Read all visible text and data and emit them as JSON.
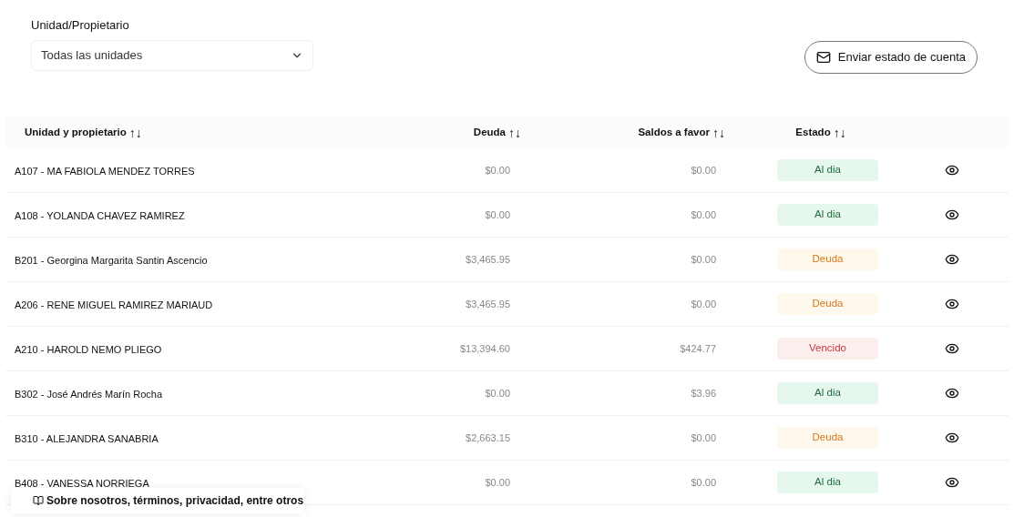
{
  "filter": {
    "label": "Unidad/Propietario",
    "value": "Todas las unidades"
  },
  "send_button": {
    "label": "Enviar estado de cuenta"
  },
  "table": {
    "columns": [
      {
        "label": "Unidad y propietario",
        "sort_icon": "↑↓"
      },
      {
        "label": "Deuda",
        "sort_icon": "↑↓"
      },
      {
        "label": "Saldos a favor",
        "sort_icon": "↑↓"
      },
      {
        "label": "Estado",
        "sort_icon": "↑↓"
      }
    ],
    "rows": [
      {
        "unit": "A107 - MA FABIOLA MENDEZ TORRES",
        "debt": "$0.00",
        "credit": "$0.00",
        "status": {
          "label": "Al dia",
          "kind": "ok"
        }
      },
      {
        "unit": "A108 - YOLANDA CHAVEZ RAMIREZ",
        "debt": "$0.00",
        "credit": "$0.00",
        "status": {
          "label": "Al dia",
          "kind": "ok"
        }
      },
      {
        "unit": "B201 - Georgina Margarita Santin Ascencio",
        "debt": "$3,465.95",
        "credit": "$0.00",
        "status": {
          "label": "Deuda",
          "kind": "debt"
        }
      },
      {
        "unit": "A206 - RENE MIGUEL RAMIREZ MARIAUD",
        "debt": "$3,465.95",
        "credit": "$0.00",
        "status": {
          "label": "Deuda",
          "kind": "debt"
        }
      },
      {
        "unit": "A210 - HAROLD NEMO PLIEGO",
        "debt": "$13,394.60",
        "credit": "$424.77",
        "status": {
          "label": "Vencido",
          "kind": "overdue"
        }
      },
      {
        "unit": "B302 - José Andrés Marín Rocha",
        "debt": "$0.00",
        "credit": "$3.96",
        "status": {
          "label": "Al dia",
          "kind": "ok"
        }
      },
      {
        "unit": "B310 - ALEJANDRA SANABRIA",
        "debt": "$2,663.15",
        "credit": "$0.00",
        "status": {
          "label": "Deuda",
          "kind": "debt"
        }
      },
      {
        "unit": "B408 - VANESSA NORRIEGA",
        "debt": "$0.00",
        "credit": "$0.00",
        "status": {
          "label": "Al dia",
          "kind": "ok"
        }
      }
    ]
  },
  "footer_link": {
    "label": "Sobre nosotros, términos, privacidad, entre otros"
  }
}
